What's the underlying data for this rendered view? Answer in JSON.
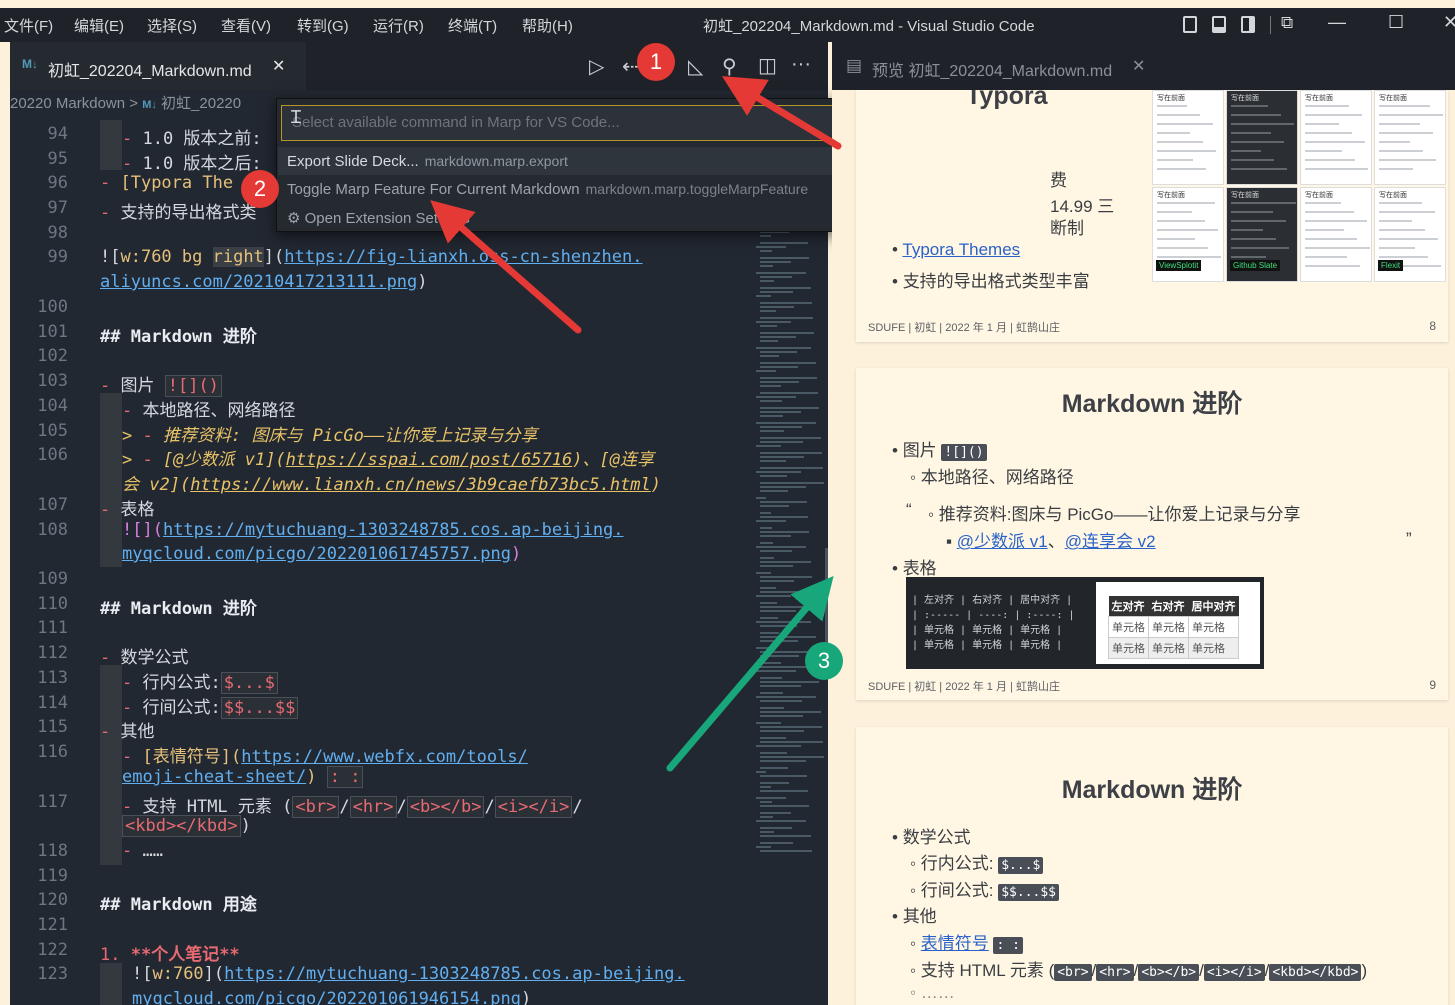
{
  "window": {
    "title": "初虹_202204_Markdown.md - Visual Studio Code"
  },
  "menubar": [
    "文件(F)",
    "编辑(E)",
    "选择(S)",
    "查看(V)",
    "转到(G)",
    "运行(R)",
    "终端(T)",
    "帮助(H)"
  ],
  "window_controls": {
    "minimize": "—",
    "maximize": "☐",
    "close": "✕",
    "customize": "⧉"
  },
  "editor_tab": {
    "icon": "M↓",
    "label": "初虹_202204_Markdown.md",
    "close": "✕"
  },
  "tab_actions": {
    "run": "▷",
    "back": "⇠",
    "marp": "◺",
    "share": "⚲",
    "split": "◫",
    "more": "···"
  },
  "preview_tab": {
    "icon": "▤",
    "label": "预览 初虹_202204_Markdown.md",
    "close": "✕"
  },
  "breadcrumb": {
    "folder": "20220",
    "file_part": "Markdown",
    "sep": ">",
    "icon": "M↓",
    "file": "初虹_20220"
  },
  "palette": {
    "placeholder": "Select available command in Marp for VS Code...",
    "items": [
      {
        "label": "Export Slide Deck...",
        "id": "markdown.marp.export"
      },
      {
        "label": "Toggle Marp Feature For Current Markdown",
        "id": "markdown.marp.toggleMarpFeature"
      },
      {
        "label": "Open Extension Settings",
        "id": ""
      }
    ]
  },
  "editor": {
    "gutter": [
      "94",
      "95",
      "96",
      "97",
      "98",
      "99",
      "",
      "100",
      "101",
      "102",
      "103",
      "104",
      "105",
      "106",
      "",
      "107",
      "108",
      "",
      "109",
      "110",
      "111",
      "112",
      "113",
      "114",
      "115",
      "116",
      "",
      "117",
      "",
      "118",
      "119",
      "120",
      "121",
      "122",
      "123",
      ""
    ],
    "lines": {
      "l94": {
        "dash": "- ",
        "text": "1.0 版本之前:"
      },
      "l95": {
        "dash": "- ",
        "text": "1.0 版本之后:"
      },
      "l96": {
        "dash": "- ",
        "text": "[Typora The"
      },
      "l97": {
        "dash": "- ",
        "text": "支持的导出格式类"
      },
      "l99a": {
        "a": "![",
        "b": "w:760 bg ",
        "c": "right",
        "d": "](",
        "e": "https://fig-lianxh.oss-cn-shenzhen."
      },
      "l99b": {
        "e": "aliyuncs.com/20210417213111.png",
        "f": ")"
      },
      "l101": {
        "hash": "## ",
        "text": "Markdown 进阶"
      },
      "l103": {
        "dash": "- ",
        "text": "图片 ",
        "code": "![]()"
      },
      "l104": {
        "dash": "- ",
        "text": "本地路径、网络路径"
      },
      "l105": {
        "gt": "> ",
        "dash": "- ",
        "text": "推荐资料: 图床与 PicGo——让你爱上记录与分享"
      },
      "l106a": {
        "gt": ">",
        "sp": "    ",
        "dash": "- ",
        "a": "[",
        "b": "@少数派 v1",
        "c": "](",
        "d": "https://sspai.com/post/65716",
        "e": ")",
        "f": "、",
        "g": "[",
        "h": "@连享"
      },
      "l106b": {
        "h": "会 v2",
        "i": "](",
        "j": "https://www.lianxh.cn/news/3b9caefb73bc5.html",
        "k": ")"
      },
      "l107": {
        "dash": "- ",
        "text": "表格"
      },
      "l108a": {
        "a": "![](",
        "b": "https://mytuchuang-1303248785.cos.ap-beijing."
      },
      "l108b": {
        "b": "myqcloud.com/picgo/202201061745757.png",
        "c": ")"
      },
      "l110": {
        "hash": "## ",
        "text": "Markdown 进阶"
      },
      "l112": {
        "dash": "- ",
        "text": "数学公式"
      },
      "l113": {
        "dash": "- ",
        "text": "行内公式:",
        "code": "$...$"
      },
      "l114": {
        "dash": "- ",
        "text": "行间公式:",
        "code": "$$...$$"
      },
      "l115": {
        "dash": "- ",
        "text": "其他"
      },
      "l116a": {
        "dash": "- ",
        "a": "[",
        "b": "表情符号",
        "c": "](",
        "d": "https://www.webfx.com/tools/"
      },
      "l116b": {
        "d": "emoji-cheat-sheet/",
        "e": ")",
        "code": ": :"
      },
      "l117a": {
        "dash": "- ",
        "text": "支持 HTML 元素 (",
        "c1": "<br>",
        "s1": "/",
        "c2": "<hr>",
        "s2": "/",
        "c3": "<b></b>",
        "s3": "/",
        "c4": "<i></i>",
        "s4": "/"
      },
      "l117b": {
        "c5": "<kbd></kbd>",
        "end": ")"
      },
      "l118": {
        "dash": "- ",
        "text": "……"
      },
      "l120": {
        "hash": "## ",
        "text": "Markdown 用途"
      },
      "l122": {
        "num": "1. ",
        "text": "**个人笔记**"
      },
      "l123a": {
        "a": "![",
        "b": "w:760",
        "c": "](",
        "d": "https://mytuchuang-1303248785.cos.ap-beijing."
      },
      "l123b": {
        "d": "myqcloud.com/picgo/202201061946154.png",
        "e": ")"
      }
    }
  },
  "slides": [
    {
      "title": "Typora",
      "partial": [
        "费",
        "14.99 三",
        "断制"
      ],
      "bullets": [
        "Typora Themes",
        "支持的导出格式类型丰富"
      ],
      "thumbs": [
        "写在前面",
        "写在前面",
        "写在前面",
        "写在前面",
        "写在前面",
        "写在前面",
        "写在前面",
        "写在前面"
      ],
      "thumb_labels": [
        "ViewSplotit",
        "Github Slate",
        "Flexit"
      ],
      "footer": "SDUFE | 初虹 | 2022 年 1 月 | 虹鹄山庄",
      "page": "8"
    },
    {
      "title": "Markdown 进阶",
      "bullets": {
        "b1": "图片",
        "b1code": "![]()",
        "b2": "本地路径、网络路径",
        "quote_open": "“",
        "b3": "推荐资料:图床与 PicGo——让你爱上记录与分享",
        "b4a": "@少数派 v1",
        "b4sep": "、",
        "b4b": "@连享会 v2",
        "quote_close": "”",
        "b5": "表格"
      },
      "table_src": [
        "| 左对齐 | 右对齐 | 居中对齐 |",
        "| :----- | ----: | :----: |",
        "| 单元格 | 单元格 | 单元格 |",
        "| 单元格 | 单元格 | 单元格 |"
      ],
      "table": {
        "headers": [
          "左对齐",
          "右对齐",
          "居中对齐"
        ],
        "rows": [
          [
            "单元格",
            "单元格",
            "单元格"
          ],
          [
            "单元格",
            "单元格",
            "单元格"
          ]
        ]
      },
      "footer": "SDUFE | 初虹 | 2022 年 1 月 | 虹鹄山庄",
      "page": "9"
    },
    {
      "title": "Markdown 进阶",
      "b1": "数学公式",
      "b2": "行内公式:",
      "b2code": "$...$",
      "b3": "行间公式:",
      "b3code": "$$...$$",
      "b4": "其他",
      "b5": "表情符号",
      "b5code": ": :",
      "b6": "支持 HTML 元素 (",
      "b6codes": [
        "<br>",
        "<hr>",
        "<b></b>",
        "<i></i>",
        "<kbd></kbd>"
      ],
      "b6sep": "/",
      "b6end": ")",
      "b7": "……"
    }
  ],
  "annotations": {
    "n1": "1",
    "n2": "2",
    "n3": "3"
  },
  "colors": {
    "red": "#e53935",
    "green": "#18a77a",
    "gold": "#b6952a"
  }
}
